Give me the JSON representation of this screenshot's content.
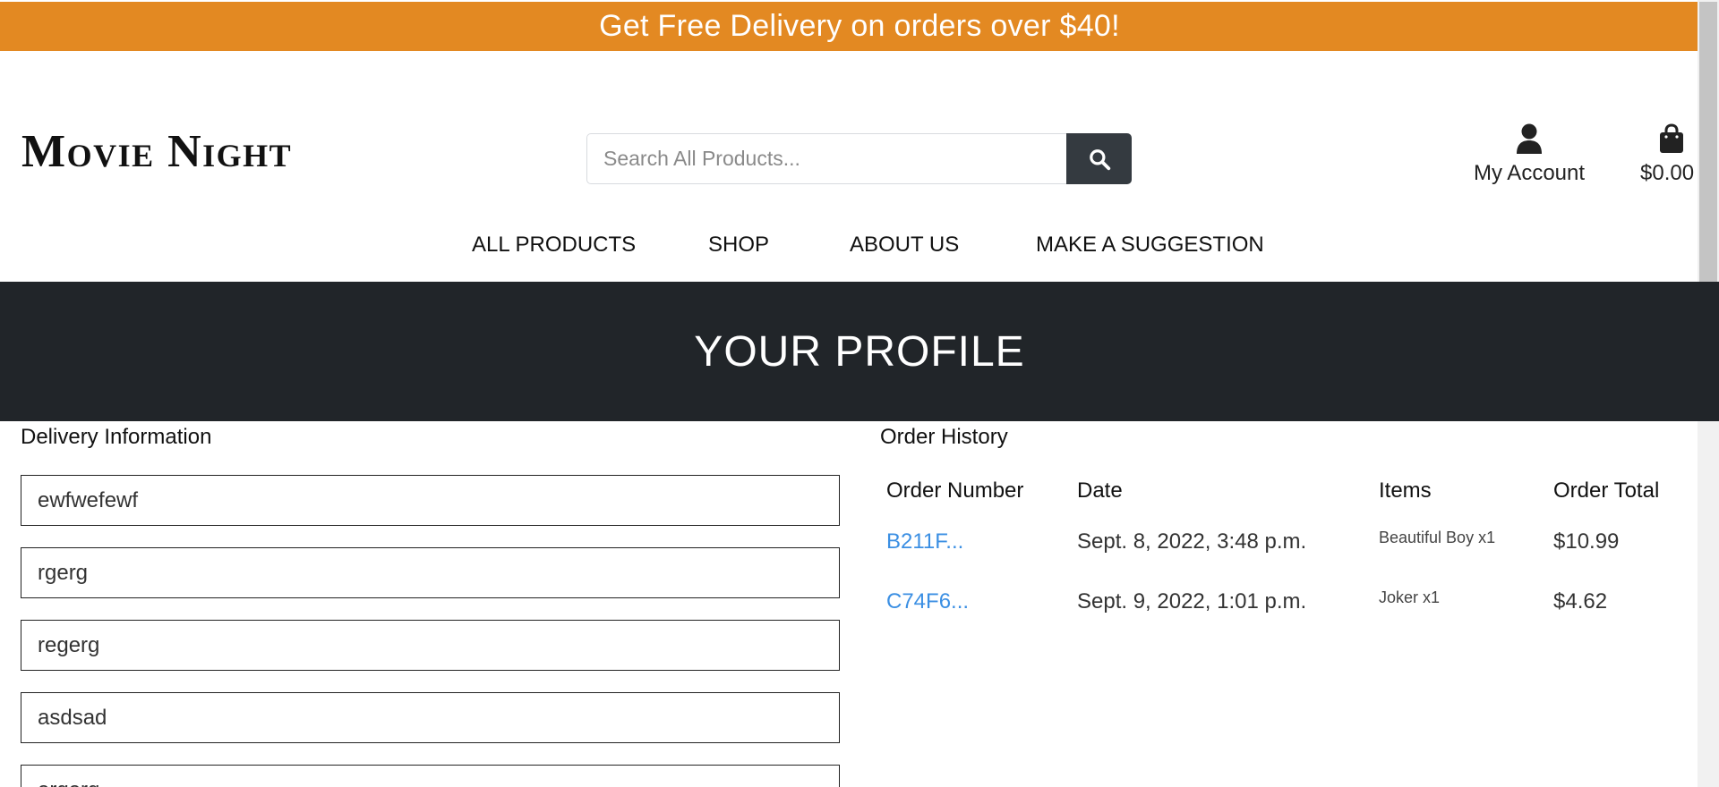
{
  "promo": {
    "text": "Get Free Delivery on orders over $40!"
  },
  "header": {
    "logo": "Movie Night",
    "search_placeholder": "Search All Products...",
    "account_label": "My Account",
    "cart_total": "$0.00"
  },
  "nav": {
    "items": [
      "ALL PRODUCTS",
      "SHOP",
      "ABOUT US",
      "MAKE A SUGGESTION"
    ]
  },
  "hero": {
    "title": "YOUR PROFILE"
  },
  "delivery": {
    "heading": "Delivery Information",
    "fields": [
      "ewfwefewf",
      "rgerg",
      "regerg",
      "asdsad",
      "ergerg"
    ]
  },
  "order_history": {
    "heading": "Order History",
    "columns": [
      "Order Number",
      "Date",
      "Items",
      "Order Total"
    ],
    "rows": [
      {
        "number": "B211F...",
        "date": "Sept. 8, 2022, 3:48 p.m.",
        "items": "Beautiful Boy x1",
        "total": "$10.99"
      },
      {
        "number": "C74F6...",
        "date": "Sept. 9, 2022, 1:01 p.m.",
        "items": "Joker x1",
        "total": "$4.62"
      }
    ]
  },
  "colors": {
    "promo_bg": "#e38922",
    "dark": "#212529",
    "search_button": "#343a40",
    "link": "#3b8fe3"
  },
  "icons": {
    "search": "search-icon",
    "account": "user-icon",
    "cart": "shopping-bag-icon"
  }
}
